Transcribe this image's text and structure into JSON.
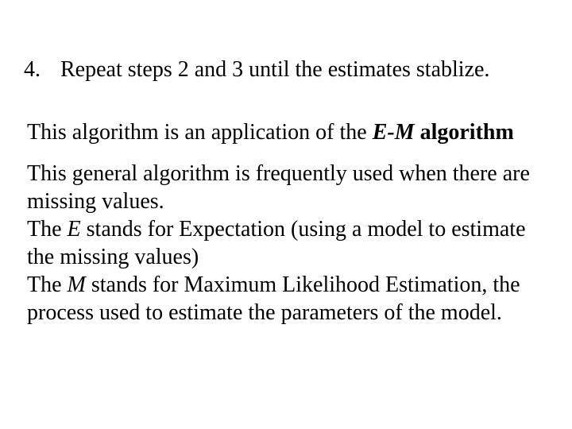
{
  "list": {
    "number": "4.",
    "text": "Repeat steps 2 and 3 until the estimates stablize."
  },
  "heading": {
    "prefix": "This algorithm is an application of the ",
    "em_term_italic": "E-M",
    "em_term_rest": " algorithm"
  },
  "body": {
    "p1": "This general algorithm is frequently used when there are missing values.",
    "p2a": "The ",
    "p2_em_E": "E",
    "p2b": " stands for Expectation (using a model to estimate the missing values)",
    "p3a": "The ",
    "p3_em_M": "M",
    "p3b": " stands for Maximum Likelihood Estimation, the process used to estimate the parameters of the model."
  }
}
